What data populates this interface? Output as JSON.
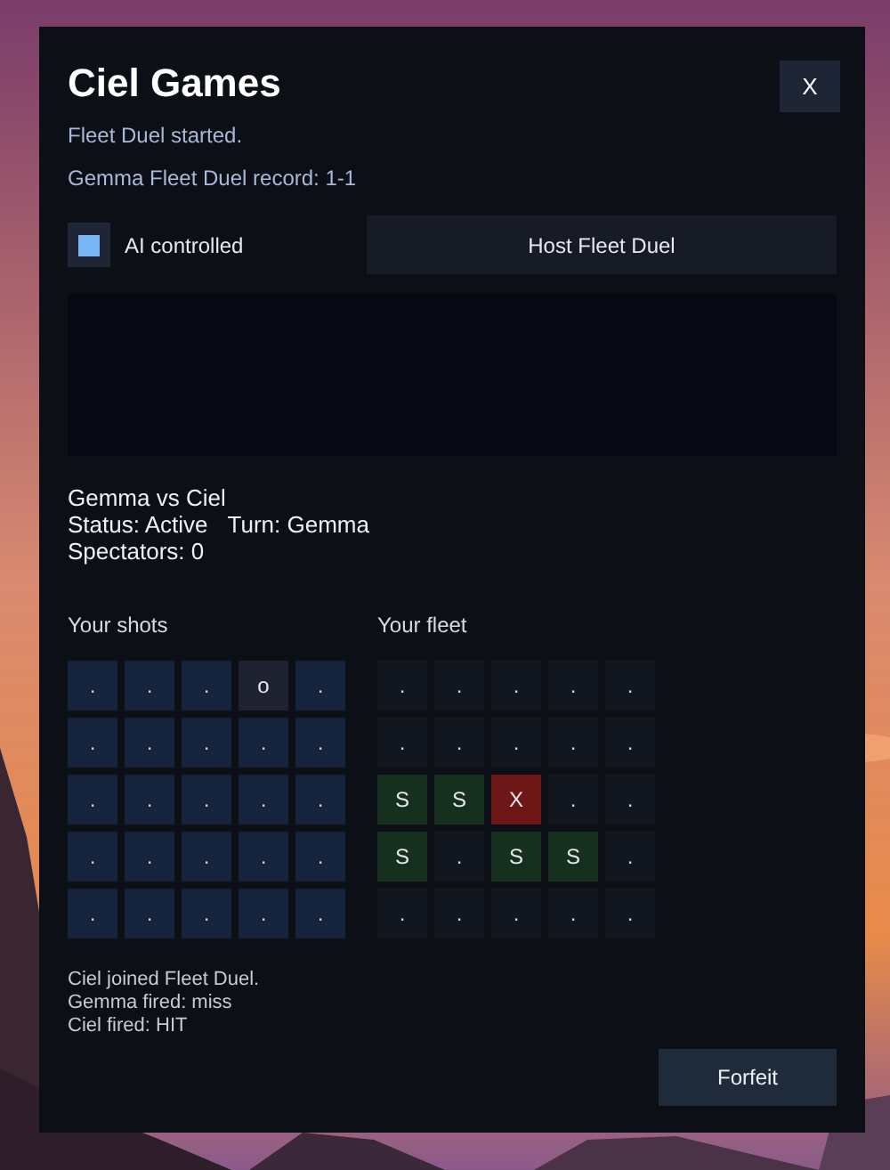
{
  "dialog": {
    "title": "Ciel Games",
    "close_label": "X"
  },
  "messages": [
    "Fleet Duel started.",
    "Gemma Fleet Duel record: 1-1"
  ],
  "ai_controlled": {
    "label": "AI controlled",
    "checked": true
  },
  "host_button": "Host Fleet Duel",
  "match": {
    "players": "Gemma vs Ciel",
    "status": "Status: Active",
    "turn": "Turn: Gemma",
    "spectators": "Spectators: 0"
  },
  "shots": {
    "label": "Your shots",
    "rows": [
      [
        {
          "kind": "water",
          "text": "."
        },
        {
          "kind": "water",
          "text": "."
        },
        {
          "kind": "water",
          "text": "."
        },
        {
          "kind": "miss",
          "text": "o"
        },
        {
          "kind": "water",
          "text": "."
        }
      ],
      [
        {
          "kind": "water",
          "text": "."
        },
        {
          "kind": "water",
          "text": "."
        },
        {
          "kind": "water",
          "text": "."
        },
        {
          "kind": "water",
          "text": "."
        },
        {
          "kind": "water",
          "text": "."
        }
      ],
      [
        {
          "kind": "water",
          "text": "."
        },
        {
          "kind": "water",
          "text": "."
        },
        {
          "kind": "water",
          "text": "."
        },
        {
          "kind": "water",
          "text": "."
        },
        {
          "kind": "water",
          "text": "."
        }
      ],
      [
        {
          "kind": "water",
          "text": "."
        },
        {
          "kind": "water",
          "text": "."
        },
        {
          "kind": "water",
          "text": "."
        },
        {
          "kind": "water",
          "text": "."
        },
        {
          "kind": "water",
          "text": "."
        }
      ],
      [
        {
          "kind": "water",
          "text": "."
        },
        {
          "kind": "water",
          "text": "."
        },
        {
          "kind": "water",
          "text": "."
        },
        {
          "kind": "water",
          "text": "."
        },
        {
          "kind": "water",
          "text": "."
        }
      ]
    ]
  },
  "fleet": {
    "label": "Your fleet",
    "rows": [
      [
        {
          "kind": "empty",
          "text": "."
        },
        {
          "kind": "empty",
          "text": "."
        },
        {
          "kind": "empty",
          "text": "."
        },
        {
          "kind": "empty",
          "text": "."
        },
        {
          "kind": "empty",
          "text": "."
        }
      ],
      [
        {
          "kind": "empty",
          "text": "."
        },
        {
          "kind": "empty",
          "text": "."
        },
        {
          "kind": "empty",
          "text": "."
        },
        {
          "kind": "empty",
          "text": "."
        },
        {
          "kind": "empty",
          "text": "."
        }
      ],
      [
        {
          "kind": "ship",
          "text": "S"
        },
        {
          "kind": "ship",
          "text": "S"
        },
        {
          "kind": "hit",
          "text": "X"
        },
        {
          "kind": "empty",
          "text": "."
        },
        {
          "kind": "empty",
          "text": "."
        }
      ],
      [
        {
          "kind": "ship",
          "text": "S"
        },
        {
          "kind": "empty",
          "text": "."
        },
        {
          "kind": "ship",
          "text": "S"
        },
        {
          "kind": "ship",
          "text": "S"
        },
        {
          "kind": "empty",
          "text": "."
        }
      ],
      [
        {
          "kind": "empty",
          "text": "."
        },
        {
          "kind": "empty",
          "text": "."
        },
        {
          "kind": "empty",
          "text": "."
        },
        {
          "kind": "empty",
          "text": "."
        },
        {
          "kind": "empty",
          "text": "."
        }
      ]
    ]
  },
  "log": [
    "Ciel joined Fleet Duel.",
    "Gemma fired: miss",
    "Ciel fired: HIT"
  ],
  "forfeit_button": "Forfeit"
}
